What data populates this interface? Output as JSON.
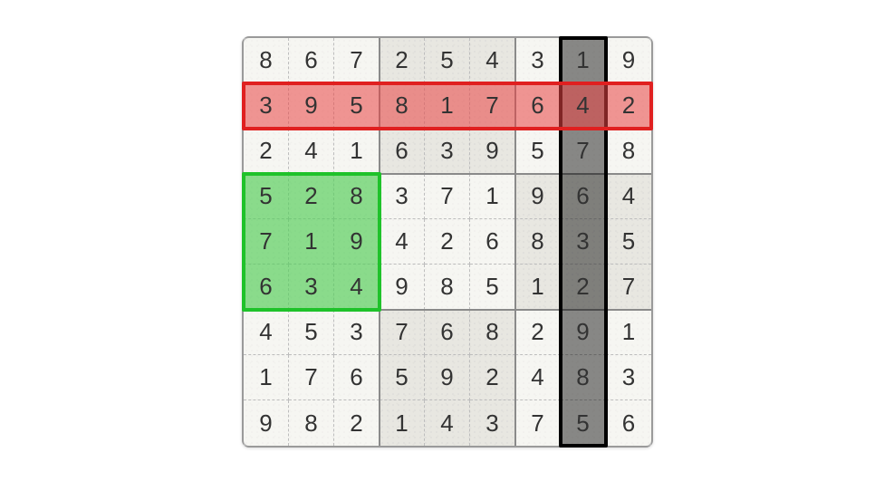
{
  "sudoku": {
    "grid": [
      [
        8,
        6,
        7,
        2,
        5,
        4,
        3,
        1,
        9
      ],
      [
        3,
        9,
        5,
        8,
        1,
        7,
        6,
        4,
        2
      ],
      [
        2,
        4,
        1,
        6,
        3,
        9,
        5,
        7,
        8
      ],
      [
        5,
        2,
        8,
        3,
        7,
        1,
        9,
        6,
        4
      ],
      [
        7,
        1,
        9,
        4,
        2,
        6,
        8,
        3,
        5
      ],
      [
        6,
        3,
        4,
        9,
        8,
        5,
        1,
        2,
        7
      ],
      [
        4,
        5,
        3,
        7,
        6,
        8,
        2,
        9,
        1
      ],
      [
        1,
        7,
        6,
        5,
        9,
        2,
        4,
        8,
        3
      ],
      [
        9,
        8,
        2,
        1,
        4,
        3,
        7,
        5,
        6
      ]
    ],
    "highlights": {
      "row": {
        "index": 1,
        "color": "red"
      },
      "column": {
        "index": 7,
        "color": "black"
      },
      "box": {
        "row": 1,
        "col": 0,
        "color": "green"
      }
    },
    "colors": {
      "red_fill": "#e94444",
      "red_border": "#e02020",
      "green_fill": "#3cd246",
      "green_border": "#1fc22a",
      "black_fill": "#000000",
      "black_border": "#000000",
      "grid_border": "#9a9a9a"
    }
  }
}
